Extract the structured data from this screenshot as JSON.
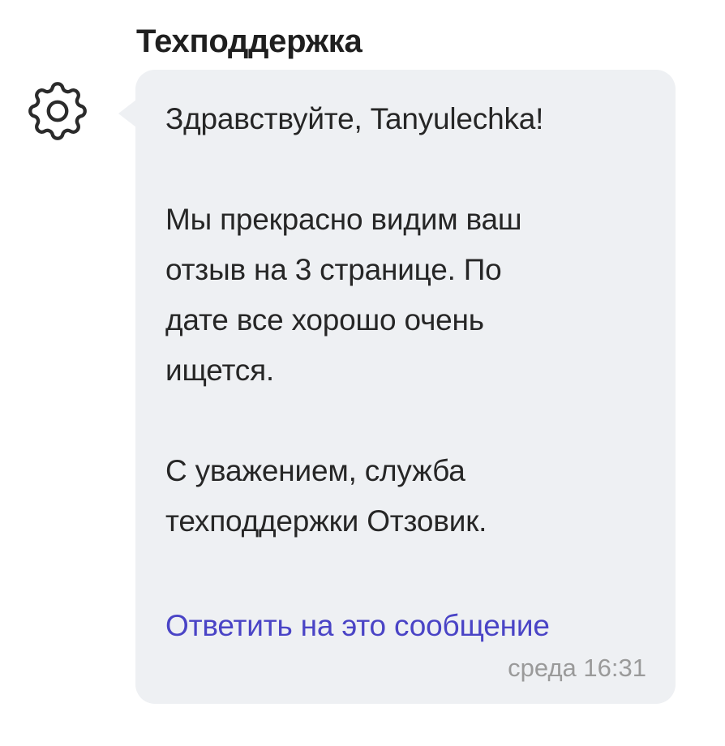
{
  "message": {
    "sender": "Техподдержка",
    "avatar_icon": "gear-icon",
    "greeting": "Здравствуйте, Tanyulechka!",
    "body_lines": [
      "Мы прекрасно видим ваш",
      "отзыв на 3 странице. По",
      "дате все хорошо очень",
      "ищется."
    ],
    "signature_lines": [
      "С уважением, служба",
      "техподдержки Отзовик."
    ],
    "reply_link": "Ответить на это сообщение",
    "timestamp": "среда 16:31"
  },
  "colors": {
    "bubble_background": "#eef0f3",
    "link": "#4a44c6",
    "timestamp": "#9a9a9a",
    "text": "#262626"
  }
}
